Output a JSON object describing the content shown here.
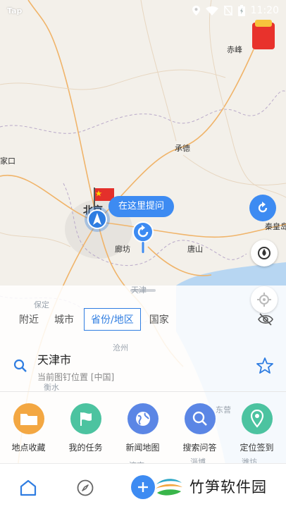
{
  "status_bar": {
    "app_name": "Tap",
    "time": "11:20"
  },
  "map": {
    "cities": [
      {
        "name": "赤峰"
      },
      {
        "name": "承德"
      },
      {
        "name": "家口"
      },
      {
        "name": "北京"
      },
      {
        "name": "廊坊"
      },
      {
        "name": "唐山"
      },
      {
        "name": "秦皇岛"
      },
      {
        "name": "天津"
      },
      {
        "name": "保定"
      },
      {
        "name": "沧州"
      },
      {
        "name": "衡水"
      },
      {
        "name": "东营"
      },
      {
        "name": "潍坊"
      },
      {
        "name": "淄博"
      },
      {
        "name": "济南"
      }
    ],
    "ask_here_label": "在这里提问"
  },
  "panel": {
    "tabs": [
      "附近",
      "城市",
      "省份/地区",
      "国家"
    ],
    "active_tab": "省份/地区",
    "location": {
      "title": "天津市",
      "subtitle": "当前图钉位置 [中国]"
    },
    "actions": [
      {
        "label": "地点收藏",
        "icon": "folder-icon",
        "color": "#f3a742"
      },
      {
        "label": "我的任务",
        "icon": "flag-icon",
        "color": "#4cc3a0"
      },
      {
        "label": "新闻地图",
        "icon": "globe-icon",
        "color": "#5b86e5"
      },
      {
        "label": "搜索问答",
        "icon": "magnifier-icon",
        "color": "#5b86e5"
      },
      {
        "label": "定位签到",
        "icon": "location-pin-icon",
        "color": "#4cc3a0"
      }
    ]
  },
  "bottom_nav": {
    "watermark_text": "竹笋软件园"
  },
  "colors": {
    "accent": "#2f7de1",
    "bubble": "#3d8bf2"
  }
}
